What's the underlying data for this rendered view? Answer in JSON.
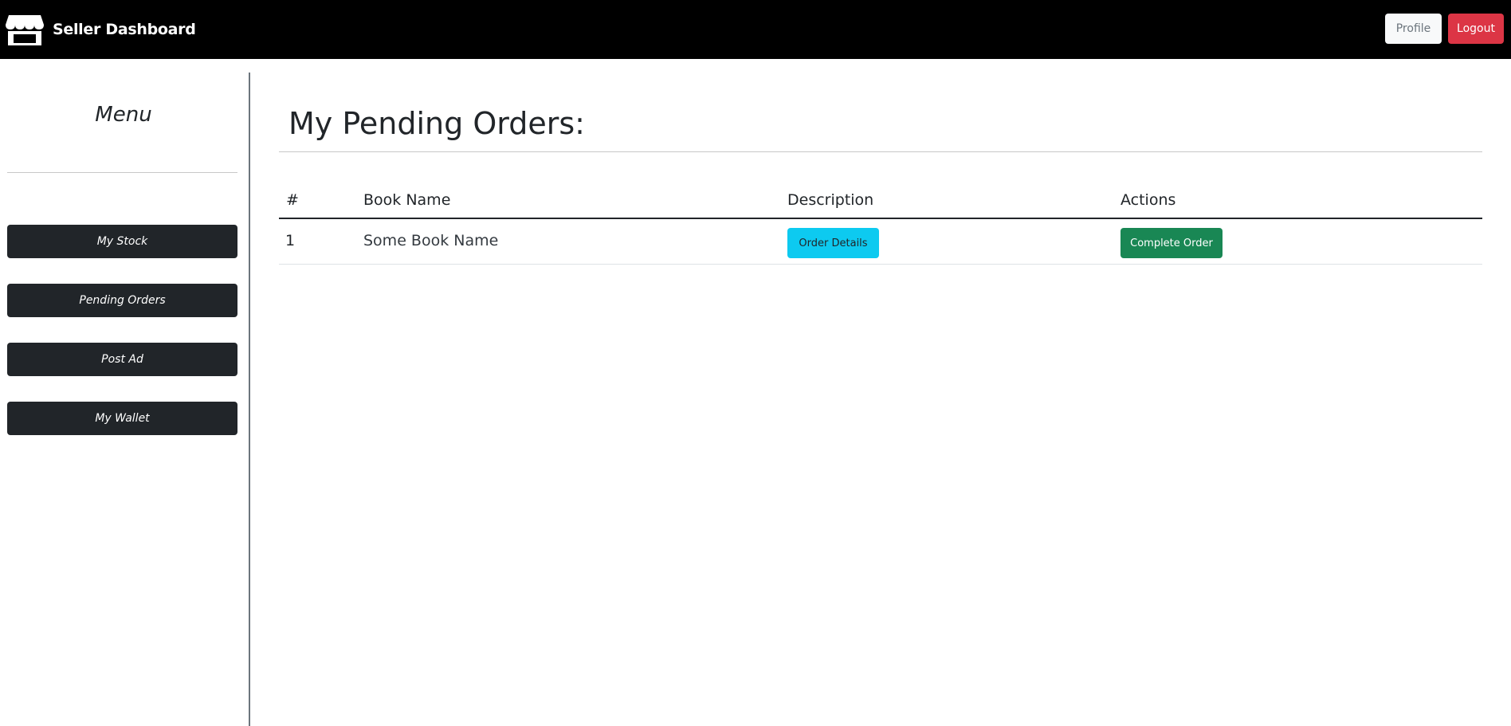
{
  "navbar": {
    "brand": "Seller Dashboard",
    "brand_icon": "store-icon",
    "profile_label": "Profile",
    "logout_label": "Logout"
  },
  "sidebar": {
    "title": "Menu",
    "items": [
      {
        "label": "My Stock"
      },
      {
        "label": "Pending Orders"
      },
      {
        "label": "Post Ad"
      },
      {
        "label": "My Wallet"
      }
    ]
  },
  "main": {
    "title": "My Pending Orders:",
    "table": {
      "headers": [
        "#",
        "Book Name",
        "Description",
        "Actions"
      ],
      "rows": [
        {
          "number": "1",
          "book_name": "Some Book Name",
          "description_button": "Order Details",
          "action_button": "Complete Order"
        }
      ]
    }
  },
  "colors": {
    "navbar_bg": "#000000",
    "logout": "#dc3545",
    "profile": "#f8f9fa",
    "sidebar_button": "#212529",
    "info": "#0dcaf0",
    "success": "#198754"
  }
}
